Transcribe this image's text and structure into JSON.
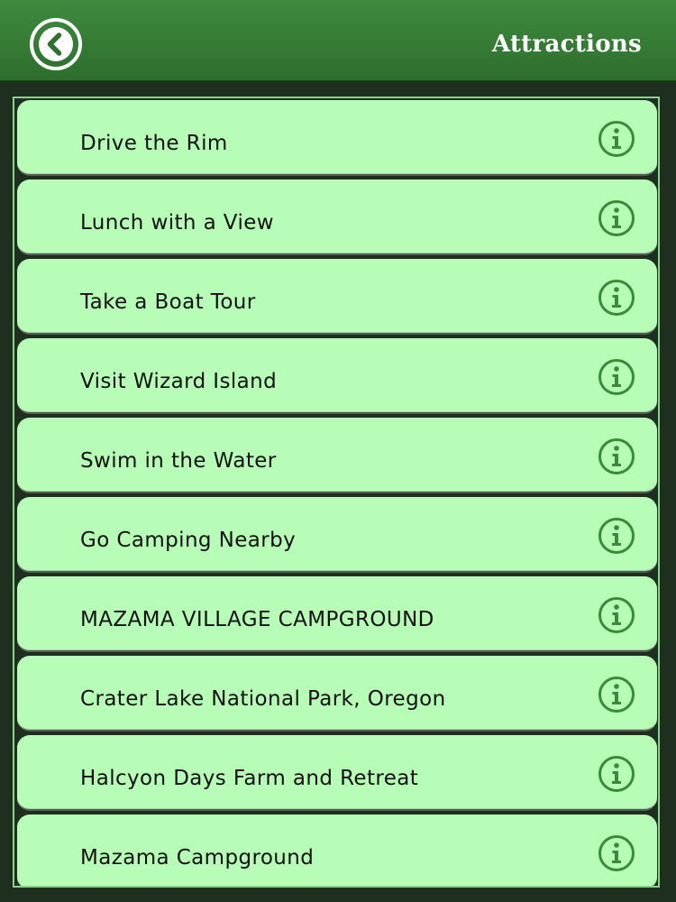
{
  "header": {
    "title": "Attractions",
    "back_icon": "chevron-left-icon"
  },
  "colors": {
    "header_green": "#3f8a3f",
    "item_background": "#b7fdb7",
    "info_icon": "#3a8a3a",
    "panel_background": "#1f2f1f"
  },
  "list": {
    "items": [
      {
        "label": "Drive the Rim",
        "icon": "info-icon"
      },
      {
        "label": "Lunch with a View",
        "icon": "info-icon"
      },
      {
        "label": "Take a Boat Tour",
        "icon": "info-icon"
      },
      {
        "label": "Visit Wizard Island",
        "icon": "info-icon"
      },
      {
        "label": "Swim in the Water",
        "icon": "info-icon"
      },
      {
        "label": "Go Camping Nearby",
        "icon": "info-icon"
      },
      {
        "label": "MAZAMA VILLAGE CAMPGROUND",
        "icon": "info-icon"
      },
      {
        "label": "Crater Lake National Park, Oregon",
        "icon": "info-icon"
      },
      {
        "label": "Halcyon Days Farm and Retreat",
        "icon": "info-icon"
      },
      {
        "label": "Mazama Campground",
        "icon": "info-icon"
      }
    ]
  }
}
